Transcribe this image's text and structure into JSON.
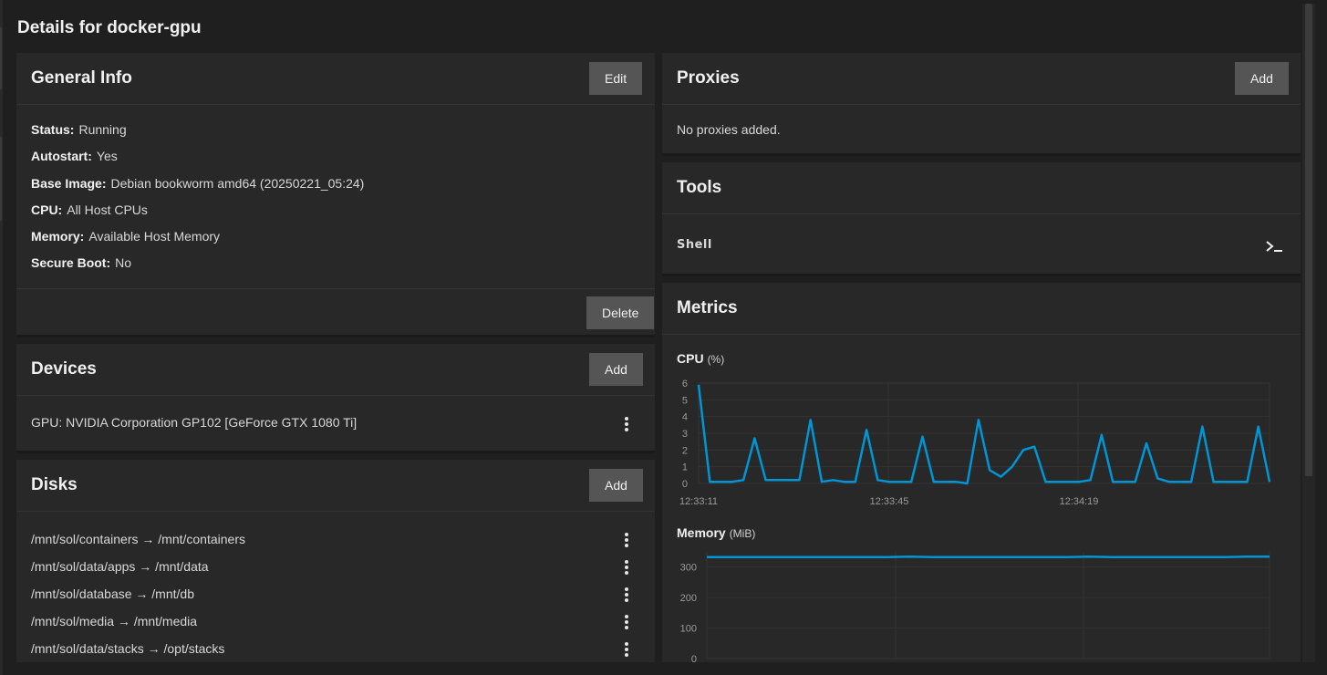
{
  "page": {
    "title": "Details for docker-gpu"
  },
  "general_info": {
    "title": "General Info",
    "edit_label": "Edit",
    "delete_label": "Delete",
    "fields": [
      {
        "key": "Status:",
        "value": "Running"
      },
      {
        "key": "Autostart:",
        "value": "Yes"
      },
      {
        "key": "Base Image:",
        "value": "Debian bookworm amd64 (20250221_05:24)"
      },
      {
        "key": "CPU:",
        "value": "All Host CPUs"
      },
      {
        "key": "Memory:",
        "value": "Available Host Memory"
      },
      {
        "key": "Secure Boot:",
        "value": "No"
      }
    ]
  },
  "devices": {
    "title": "Devices",
    "add_label": "Add",
    "items": [
      "GPU: NVIDIA Corporation GP102 [GeForce GTX 1080 Ti]"
    ]
  },
  "disks": {
    "title": "Disks",
    "add_label": "Add",
    "items": [
      "/mnt/sol/containers → /mnt/containers",
      "/mnt/sol/data/apps → /mnt/data",
      "/mnt/sol/database → /mnt/db",
      "/mnt/sol/media → /mnt/media",
      "/mnt/sol/data/stacks → /opt/stacks"
    ]
  },
  "proxies": {
    "title": "Proxies",
    "add_label": "Add",
    "empty_text": "No proxies added."
  },
  "tools": {
    "title": "Tools",
    "shell_label": "Shell",
    "shell_icon": "terminal-icon"
  },
  "metrics": {
    "title": "Metrics",
    "cpu_label": "CPU",
    "cpu_unit": "(%)",
    "memory_label": "Memory",
    "memory_unit": "(MiB)"
  },
  "colors": {
    "accent": "#0095d5",
    "background": "#1f1f1f",
    "card": "#282828",
    "button": "#555555"
  },
  "chart_data": [
    {
      "type": "line",
      "title": "CPU (%)",
      "ylim": [
        0,
        6
      ],
      "yticks": [
        "0",
        "1",
        "2",
        "3",
        "4",
        "5",
        "6"
      ],
      "xticks": [
        "12:33:11",
        "12:33:45",
        "12:34:19"
      ],
      "series": [
        {
          "values": [
            5.9,
            0.1,
            0.1,
            0.1,
            0.2,
            2.7,
            0.2,
            0.2,
            0.2,
            0.2,
            3.8,
            0.1,
            0.2,
            0.1,
            0.1,
            3.2,
            0.2,
            0.1,
            0.1,
            0.1,
            2.8,
            0.1,
            0.1,
            0.1,
            0.0,
            3.8,
            0.8,
            0.4,
            1.0,
            2.0,
            2.2,
            0.1,
            0.1,
            0.1,
            0.1,
            0.2,
            2.9,
            0.1,
            0.1,
            0.1,
            2.4,
            0.3,
            0.1,
            0.1,
            0.1,
            3.4,
            0.1,
            0.1,
            0.1,
            0.1,
            3.4,
            0.1
          ]
        }
      ],
      "grid": true
    },
    {
      "type": "line",
      "title": "Memory (MiB)",
      "ylim": [
        0,
        350
      ],
      "yticks": [
        "0",
        "100",
        "200",
        "300"
      ],
      "series": [
        {
          "values": [
            333,
            333,
            333,
            333,
            333,
            333,
            333,
            333,
            333,
            334,
            333,
            333,
            333,
            333,
            333,
            333,
            333,
            334,
            333,
            333,
            333,
            333,
            333,
            333,
            334,
            334
          ]
        }
      ],
      "grid": true
    }
  ]
}
